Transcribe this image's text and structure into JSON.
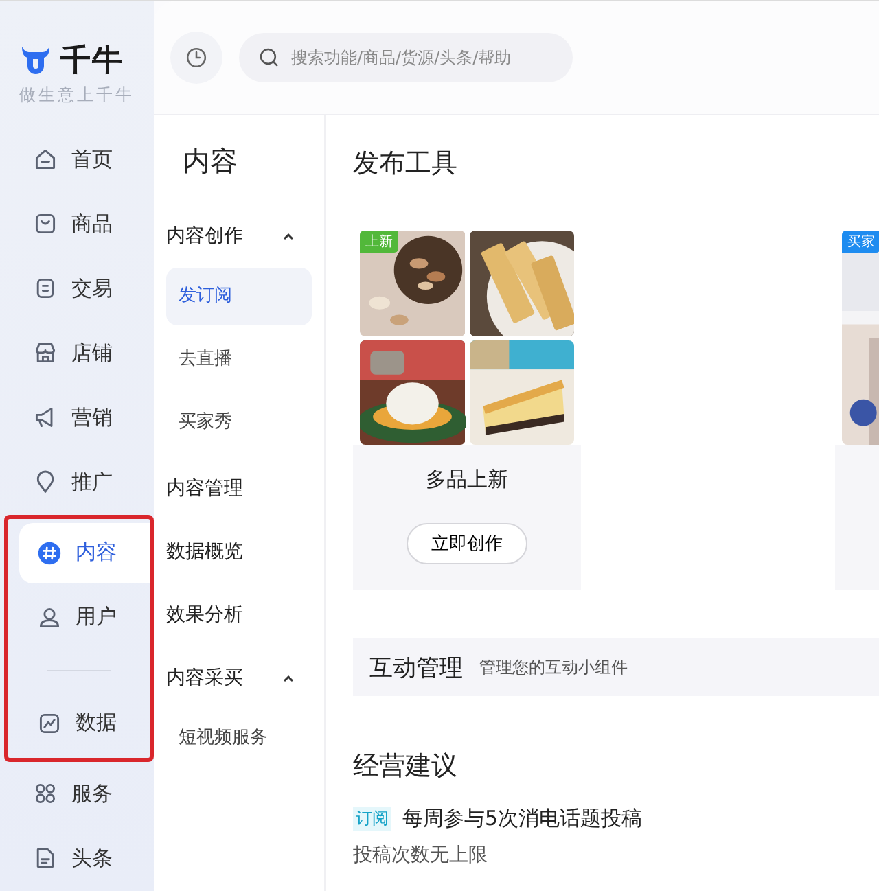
{
  "logo": {
    "name": "千牛",
    "slogan": "做生意上千牛"
  },
  "sidebar": {
    "items": [
      {
        "kind": "item",
        "label": "首页",
        "selected": false,
        "framed": false
      },
      {
        "kind": "item",
        "label": "商品",
        "selected": false,
        "framed": false
      },
      {
        "kind": "item",
        "label": "交易",
        "selected": false,
        "framed": false
      },
      {
        "kind": "item",
        "label": "店铺",
        "selected": false,
        "framed": false
      },
      {
        "kind": "item",
        "label": "营销",
        "selected": false,
        "framed": false
      },
      {
        "kind": "item",
        "label": "推广",
        "selected": false,
        "framed": false
      },
      {
        "kind": "item",
        "label": "内容",
        "selected": true,
        "framed": true
      },
      {
        "kind": "item",
        "label": "用户",
        "selected": false,
        "framed": true
      },
      {
        "kind": "divider",
        "framed": true
      },
      {
        "kind": "item",
        "label": "数据",
        "selected": false,
        "framed": true
      },
      {
        "kind": "item",
        "label": "服务",
        "selected": false,
        "framed": false
      },
      {
        "kind": "item",
        "label": "头条",
        "selected": false,
        "framed": false
      }
    ]
  },
  "topbar": {
    "search": {
      "placeholder": "搜索功能/商品/货源/头条/帮助"
    }
  },
  "subnav": {
    "title": "内容",
    "items": [
      {
        "kind": "group",
        "label": "内容创作",
        "expanded": true,
        "children": [
          {
            "label": "发订阅",
            "selected": true
          },
          {
            "label": "去直播",
            "selected": false
          },
          {
            "label": "买家秀",
            "selected": false
          }
        ]
      },
      {
        "kind": "link",
        "label": "内容管理"
      },
      {
        "kind": "link",
        "label": "数据概览"
      },
      {
        "kind": "link",
        "label": "效果分析"
      },
      {
        "kind": "group",
        "label": "内容采买",
        "expanded": true,
        "children": [
          {
            "label": "短视频服务",
            "selected": false
          }
        ]
      }
    ]
  },
  "tools": {
    "title": "发布工具",
    "cards": [
      {
        "badge": "上新",
        "color": "#52b83a",
        "name": "多品上新",
        "button": "立即创作"
      },
      {
        "badge": "买家",
        "color": "#1e8cf0"
      }
    ]
  },
  "interaction": {
    "title": "互动管理",
    "description": "管理您的互动小组件"
  },
  "advice": {
    "title": "经营建议",
    "items": [
      {
        "tag": "订阅",
        "title": "每周参与5次消电话题投稿",
        "detail": "投稿次数无上限"
      }
    ]
  }
}
